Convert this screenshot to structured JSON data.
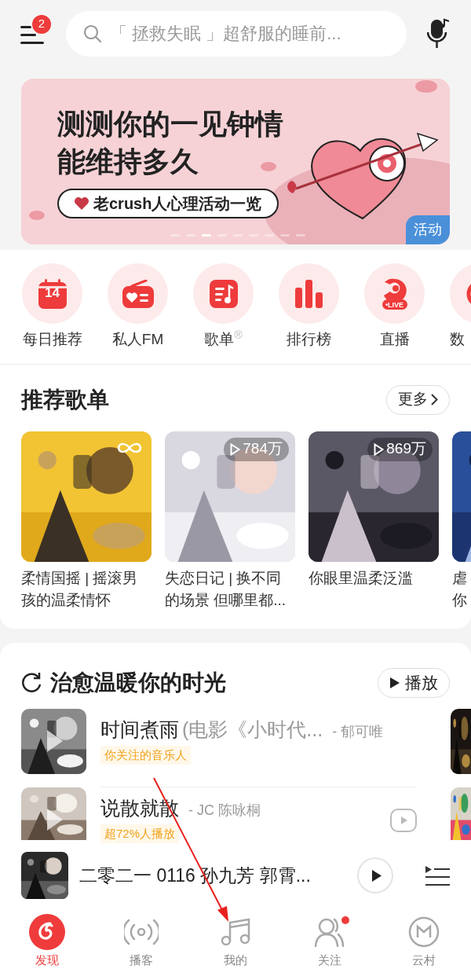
{
  "header": {
    "menu_badge": "2",
    "search": {
      "placeholder": "「 拯救失眠 」超舒服的睡前..."
    }
  },
  "banner": {
    "headline": [
      "测测你的一见钟情",
      "能维持多久"
    ],
    "link": "老crush人心理活动一览",
    "tag": "活动"
  },
  "shortcuts": [
    {
      "kind": "calendar",
      "label": "每日推荐",
      "icon_text": "14"
    },
    {
      "kind": "radio",
      "label": "私人FM"
    },
    {
      "kind": "playlist",
      "label": "歌单$^{®}$"
    },
    {
      "kind": "chart",
      "label": "排行榜"
    },
    {
      "kind": "live",
      "label": "直播",
      "icon_text": "•LIVE"
    },
    {
      "kind": "partial",
      "label": "数"
    }
  ],
  "playlists": {
    "title": "推荐歌单",
    "more": "更多",
    "items": [
      {
        "title": "柔情国摇 | 摇滚男孩的温柔情怀",
        "loop": true
      },
      {
        "title": "失恋日记 | 换不同的场景 但哪里都...",
        "plays": "784万",
        "loop": false
      },
      {
        "title": "你眼里温柔泛滥",
        "plays": "869万",
        "loop": false
      },
      {
        "title": "虐你",
        "loop": false
      }
    ]
  },
  "songs": {
    "title": "治愈温暖你的时光",
    "play": "播放",
    "items": [
      {
        "title": "时间煮雨",
        "subtitle": "(电影《小时代...",
        "artist": "- 郁可唯",
        "tag": "你关注的音乐人",
        "mv": false
      },
      {
        "title": "说散就散",
        "artist": "- JC 陈咏桐",
        "tag": "超72%人播放",
        "mv": true
      }
    ]
  },
  "now_playing": {
    "title": "二零二一 0116 孙九芳 郭霄..."
  },
  "tabs": [
    {
      "kind": "discover",
      "label": "发现",
      "selected": true,
      "dot": false
    },
    {
      "kind": "podcast",
      "label": "播客",
      "selected": false,
      "dot": false
    },
    {
      "kind": "mine",
      "label": "我的",
      "selected": false,
      "dot": false
    },
    {
      "kind": "follow",
      "label": "关注",
      "selected": false,
      "dot": true
    },
    {
      "kind": "village",
      "label": "云村",
      "selected": false,
      "dot": false
    }
  ]
}
